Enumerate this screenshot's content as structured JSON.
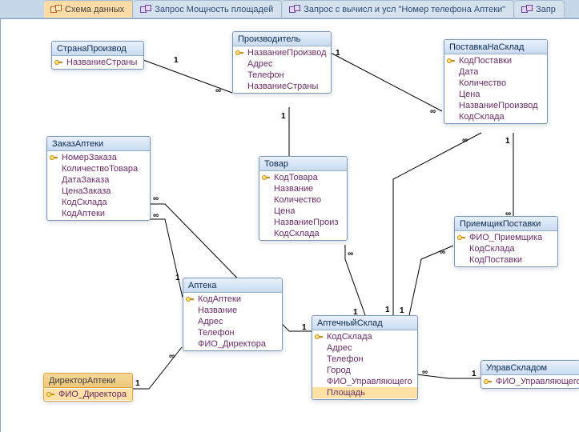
{
  "tabs": [
    {
      "label": "Схема данных",
      "icon": "relationships",
      "active": true
    },
    {
      "label": "Запрос Мощность площадей",
      "icon": "query",
      "active": false
    },
    {
      "label": "Запрос с вычисл и усл \"Номер телефона Аптеки\"",
      "icon": "query",
      "active": false
    },
    {
      "label": "Запр",
      "icon": "query",
      "active": false
    }
  ],
  "entities": {
    "strana_proizvod": {
      "title": "СтранаПроизвод",
      "fields": [
        {
          "name": "НазваниеСтраны",
          "pk": true
        }
      ]
    },
    "proizvoditel": {
      "title": "Производитель",
      "fields": [
        {
          "name": "НазваниеПроизвод",
          "pk": true
        },
        {
          "name": "Адрес",
          "pk": false
        },
        {
          "name": "Телефон",
          "pk": false
        },
        {
          "name": "НазваниеСтраны",
          "pk": false
        }
      ]
    },
    "postavka_na_sklad": {
      "title": "ПоставкаНаСклад",
      "fields": [
        {
          "name": "КодПоставки",
          "pk": true
        },
        {
          "name": "Дата",
          "pk": false
        },
        {
          "name": "Количество",
          "pk": false
        },
        {
          "name": "Цена",
          "pk": false
        },
        {
          "name": "НазваниеПроизвод",
          "pk": false
        },
        {
          "name": "КодСклада",
          "pk": false
        }
      ]
    },
    "zakaz_apteki": {
      "title": "ЗаказАптеки",
      "fields": [
        {
          "name": "НомерЗаказа",
          "pk": true
        },
        {
          "name": "КоличествоТовара",
          "pk": false
        },
        {
          "name": "ДатаЗаказа",
          "pk": false
        },
        {
          "name": "ЦенаЗаказа",
          "pk": false
        },
        {
          "name": "КодСклада",
          "pk": false
        },
        {
          "name": "КодАптеки",
          "pk": false
        }
      ]
    },
    "tovar": {
      "title": "Товар",
      "fields": [
        {
          "name": "КодТовара",
          "pk": true
        },
        {
          "name": "Название",
          "pk": false
        },
        {
          "name": "Количество",
          "pk": false
        },
        {
          "name": "Цена",
          "pk": false
        },
        {
          "name": "НазваниеПроиз",
          "pk": false
        },
        {
          "name": "КодСклада",
          "pk": false
        }
      ]
    },
    "priemshik_postavki": {
      "title": "ПриемщикПоставки",
      "fields": [
        {
          "name": "ФИО_Приемщика",
          "pk": true
        },
        {
          "name": "КодСклада",
          "pk": false
        },
        {
          "name": "КодПоставки",
          "pk": false
        }
      ]
    },
    "apteka": {
      "title": "Аптека",
      "fields": [
        {
          "name": "КодАптеки",
          "pk": true
        },
        {
          "name": "Название",
          "pk": false
        },
        {
          "name": "Адрес",
          "pk": false
        },
        {
          "name": "Телефон",
          "pk": false
        },
        {
          "name": "ФИО_Директора",
          "pk": false
        }
      ]
    },
    "aptechnyj_sklad": {
      "title": "АптечныйСклад",
      "fields": [
        {
          "name": "КодСклада",
          "pk": true
        },
        {
          "name": "Адрес",
          "pk": false
        },
        {
          "name": "Телефон",
          "pk": false
        },
        {
          "name": "Город",
          "pk": false
        },
        {
          "name": "ФИО_Управляющего",
          "pk": false
        },
        {
          "name": "Площадь",
          "pk": false,
          "selected": true
        }
      ]
    },
    "direktor_apteki": {
      "title": "ДиректорАптеки",
      "fields": [
        {
          "name": "ФИО_Директора",
          "pk": true,
          "selected": true
        }
      ]
    },
    "uprav_skladom": {
      "title": "УправСкладом",
      "fields": [
        {
          "name": "ФИО_Управляющего",
          "pk": true
        }
      ]
    }
  },
  "relationship_labels": {
    "one": "1",
    "many": "∞"
  }
}
